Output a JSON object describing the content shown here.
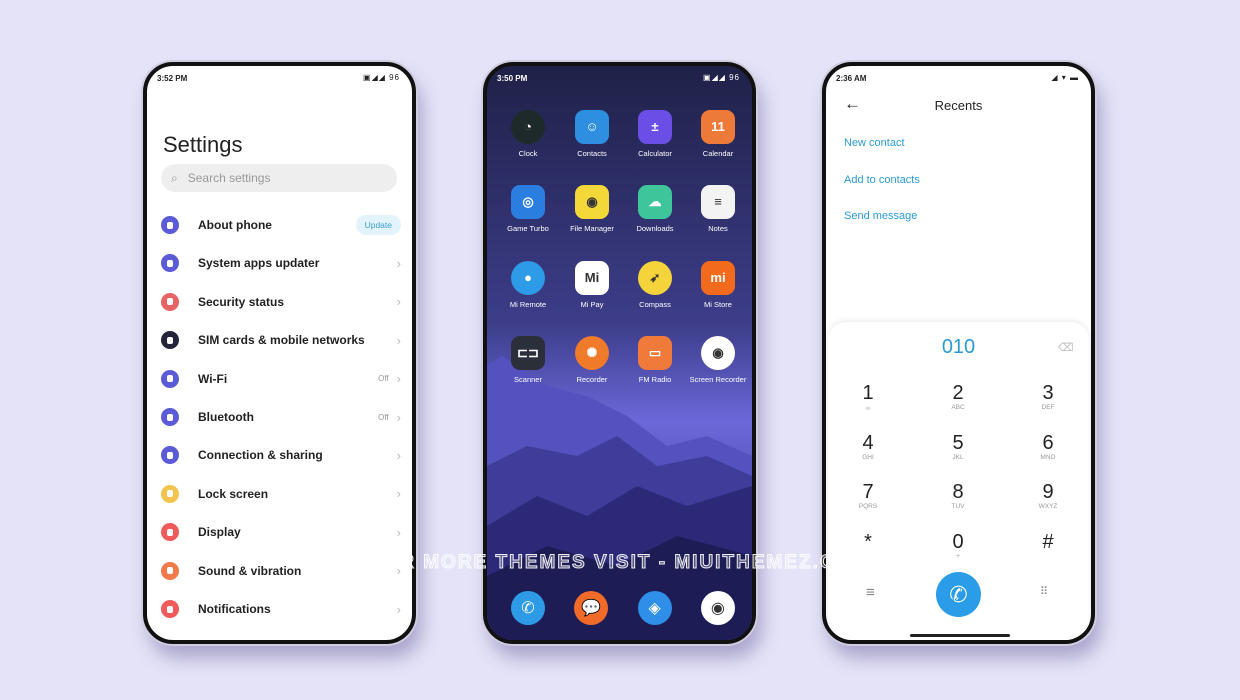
{
  "settings": {
    "time": "3:52 PM",
    "status": "▣◢◢ 96",
    "title": "Settings",
    "search_placeholder": "Search settings",
    "items": [
      {
        "label": "About phone",
        "badge": "Update",
        "color": "#5b5bd6"
      },
      {
        "label": "System apps updater",
        "color": "#5b5bd6"
      },
      {
        "label": "Security status",
        "color": "#e86464"
      },
      {
        "label": "SIM cards & mobile networks",
        "color": "#23243a"
      },
      {
        "label": "Wi-Fi",
        "value": "Off",
        "color": "#5b5bd6"
      },
      {
        "label": "Bluetooth",
        "value": "Off",
        "color": "#5b5bd6"
      },
      {
        "label": "Connection & sharing",
        "color": "#5b5bd6"
      },
      {
        "label": "Lock screen",
        "color": "#f3c44e"
      },
      {
        "label": "Display",
        "color": "#ef5a5a"
      },
      {
        "label": "Sound & vibration",
        "color": "#f07a4a"
      },
      {
        "label": "Notifications",
        "color": "#ef5a5a"
      }
    ]
  },
  "home": {
    "time": "3:50 PM",
    "status": "▣◢◢ 96",
    "apps": [
      {
        "label": "Clock",
        "icon": "clock-icon",
        "bg": "#1e2a2a",
        "glyph": "◔"
      },
      {
        "label": "Contacts",
        "icon": "contacts-icon",
        "bg": "#2e8fe0",
        "glyph": "☺"
      },
      {
        "label": "Calculator",
        "icon": "calculator-icon",
        "bg": "#6a4ee6",
        "glyph": "±"
      },
      {
        "label": "Calendar",
        "icon": "calendar-icon",
        "bg": "#ee7a3a",
        "glyph": "11"
      },
      {
        "label": "Game Turbo",
        "icon": "game-turbo-icon",
        "bg": "#2a7ee0",
        "glyph": "◎"
      },
      {
        "label": "File Manager",
        "icon": "file-manager-icon",
        "bg": "#f4d83a",
        "glyph": "◉"
      },
      {
        "label": "Downloads",
        "icon": "downloads-icon",
        "bg": "#3fc59a",
        "glyph": "☁"
      },
      {
        "label": "Notes",
        "icon": "notes-icon",
        "bg": "#f3f3f3",
        "glyph": "≡"
      },
      {
        "label": "Mi Remote",
        "icon": "mi-remote-icon",
        "bg": "#2e9be8",
        "glyph": "●"
      },
      {
        "label": "Mi Pay",
        "icon": "mi-pay-icon",
        "bg": "#ffffff",
        "glyph": "Mi"
      },
      {
        "label": "Compass",
        "icon": "compass-icon",
        "bg": "#f4d43a",
        "glyph": "➶"
      },
      {
        "label": "Mi Store",
        "icon": "mi-store-icon",
        "bg": "#f26a1c",
        "glyph": "mi"
      },
      {
        "label": "Scanner",
        "icon": "scanner-icon",
        "bg": "#2a2f3a",
        "glyph": "⊏⊐"
      },
      {
        "label": "Recorder",
        "icon": "recorder-icon",
        "bg": "#ee7a2a",
        "glyph": "✺"
      },
      {
        "label": "FM Radio",
        "icon": "fm-radio-icon",
        "bg": "#f07a3a",
        "glyph": "▭"
      },
      {
        "label": "Screen Recorder",
        "icon": "screen-recorder-icon",
        "bg": "#ffffff",
        "glyph": "◉"
      }
    ],
    "dock": [
      {
        "icon": "phone-icon",
        "bg": "#2e9be8",
        "glyph": "✆"
      },
      {
        "icon": "messages-icon",
        "bg": "#f26a2a",
        "glyph": "💬"
      },
      {
        "icon": "browser-icon",
        "bg": "#2e8ee8",
        "glyph": "◈"
      },
      {
        "icon": "camera-icon",
        "bg": "#ffffff",
        "glyph": "◉"
      }
    ]
  },
  "dialer": {
    "time": "2:36 AM",
    "status": "◢ ▾ ▬",
    "title": "Recents",
    "links": [
      "New contact",
      "Add to contacts",
      "Send message"
    ],
    "number": "010",
    "keys": [
      [
        "1",
        "ₒₒ"
      ],
      [
        "2",
        "ABC"
      ],
      [
        "3",
        "DEF"
      ],
      [
        "4",
        "GHI"
      ],
      [
        "5",
        "JKL"
      ],
      [
        "6",
        "MNO"
      ],
      [
        "7",
        "PQRS"
      ],
      [
        "8",
        "TUV"
      ],
      [
        "9",
        "WXYZ"
      ],
      [
        "*",
        ""
      ],
      [
        "0",
        "+"
      ],
      [
        "#",
        ""
      ]
    ],
    "accent": "#2b9de8"
  },
  "watermark": "FOR MORE THEMES VISIT - MIUITHEMEZ.COM"
}
